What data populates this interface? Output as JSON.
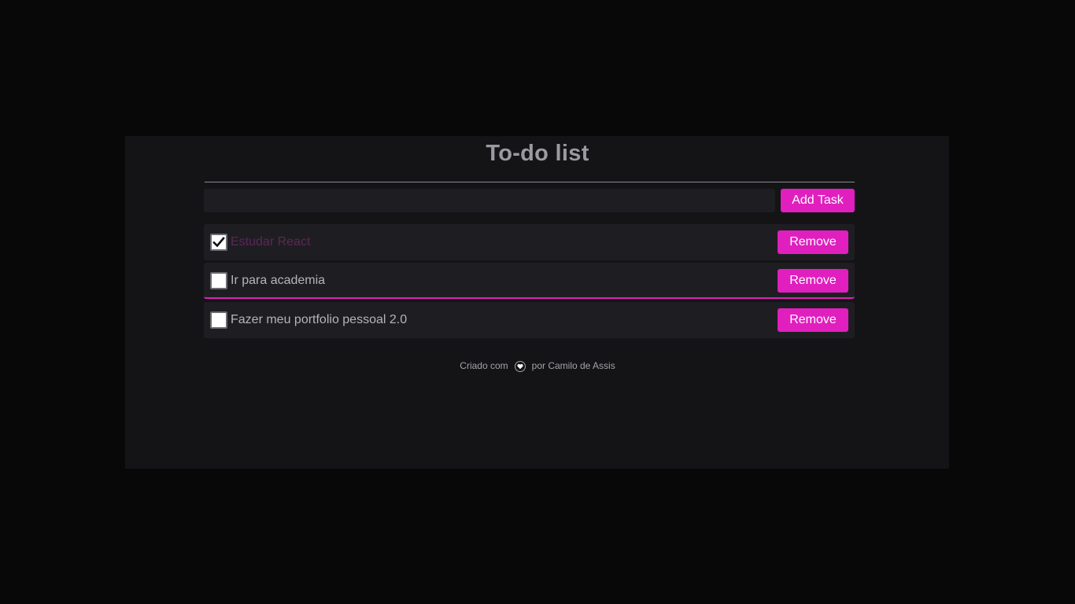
{
  "header": {
    "title": "To-do list"
  },
  "new_task": {
    "value": "",
    "placeholder": "",
    "add_label": "Add Task"
  },
  "tasks": [
    {
      "label": "Estudar React",
      "completed": true,
      "remove_label": "Remove"
    },
    {
      "label": "Ir para academia",
      "completed": false,
      "remove_label": "Remove"
    },
    {
      "label": "Fazer meu portfolio pessoal 2.0",
      "completed": false,
      "remove_label": "Remove"
    }
  ],
  "footer": {
    "prefix": "Criado com",
    "icon": "heart-icon",
    "suffix": "por Camilo de Assis"
  },
  "colors": {
    "accent": "#e01fbe",
    "background": "#080809",
    "card": "#141417",
    "row": "#1e1e22",
    "completed_text": "#5e2558"
  }
}
